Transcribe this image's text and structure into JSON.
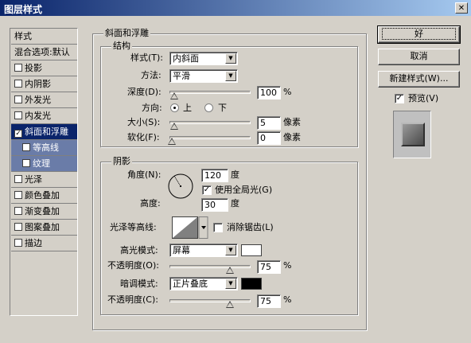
{
  "window": {
    "title": "图层样式",
    "close_glyph": "✕"
  },
  "sidebar": {
    "header": "样式",
    "blend": "混合选项:默认",
    "items": [
      {
        "label": "投影",
        "checked": false
      },
      {
        "label": "内阴影",
        "checked": false
      },
      {
        "label": "外发光",
        "checked": false
      },
      {
        "label": "内发光",
        "checked": false
      },
      {
        "label": "斜面和浮雕",
        "checked": true
      },
      {
        "label": "等高线",
        "checked": false
      },
      {
        "label": "纹理",
        "checked": false
      },
      {
        "label": "光泽",
        "checked": false
      },
      {
        "label": "颜色叠加",
        "checked": false
      },
      {
        "label": "渐变叠加",
        "checked": false
      },
      {
        "label": "图案叠加",
        "checked": false
      },
      {
        "label": "描边",
        "checked": false
      }
    ]
  },
  "bevel": {
    "group_title": "斜面和浮雕",
    "structure": {
      "title": "结构",
      "style_label": "样式(T):",
      "style_value": "内斜面",
      "technique_label": "方法:",
      "technique_value": "平滑",
      "depth_label": "深度(D):",
      "depth_value": "100",
      "depth_unit": "%",
      "direction_label": "方向:",
      "direction_up": "上",
      "direction_down": "下",
      "size_label": "大小(S):",
      "size_value": "5",
      "size_unit": "像素",
      "soften_label": "软化(F):",
      "soften_value": "0",
      "soften_unit": "像素"
    },
    "shading": {
      "title": "阴影",
      "angle_label": "角度(N):",
      "angle_value": "120",
      "angle_unit": "度",
      "global_light_label": "使用全局光(G)",
      "altitude_label": "高度:",
      "altitude_value": "30",
      "altitude_unit": "度",
      "gloss_label": "光泽等高线:",
      "antialias_label": "消除锯齿(L)",
      "highlight_mode_label": "高光模式:",
      "highlight_mode_value": "屏幕",
      "highlight_color": "#ffffff",
      "highlight_opacity_label": "不透明度(O):",
      "highlight_opacity_value": "75",
      "shadow_mode_label": "暗调模式:",
      "shadow_mode_value": "正片叠底",
      "shadow_color": "#000000",
      "shadow_opacity_label": "不透明度(C):",
      "shadow_opacity_value": "75",
      "percent": "%"
    }
  },
  "actions": {
    "ok": "好",
    "cancel": "取消",
    "new_style": "新建样式(W)...",
    "preview": "预览(V)"
  }
}
